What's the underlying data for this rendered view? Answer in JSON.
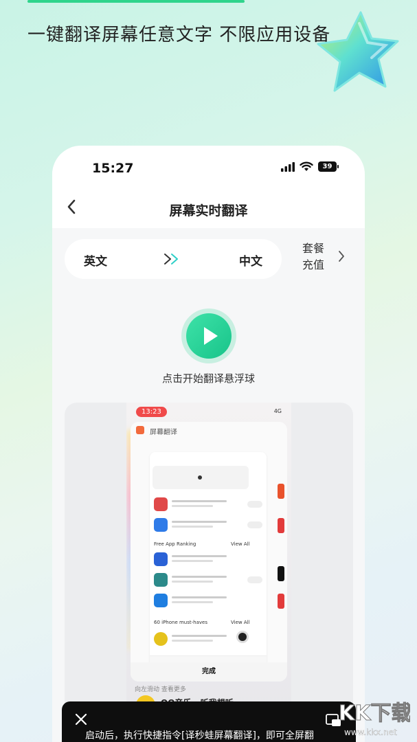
{
  "headline": "一键翻译屏幕任意文字 不限应用设备",
  "status": {
    "time": "15:27",
    "battery": "39"
  },
  "nav": {
    "title": "屏幕实时翻译"
  },
  "lang": {
    "from": "英文",
    "to": "中文"
  },
  "plan": {
    "line1": "套餐",
    "line2": "充值"
  },
  "play": {
    "caption": "点击开始翻译悬浮球"
  },
  "preview": {
    "status_time": "13:23",
    "status_right": "4G",
    "app_title": "屏幕翻译",
    "section1": "Free App Ranking",
    "section1_right": "View All",
    "section2": "60 iPhone must-haves",
    "section2_right": "View All",
    "done_label": "完成",
    "hint": "向左滑动 查看更多",
    "music": "QQ音乐 - 听我想听"
  },
  "toast": {
    "message": "启动后，执行快捷指令[译秒蛙屏幕翻译]，即可全屏翻"
  },
  "watermark": {
    "text": "KK下载",
    "url": "www.kkx.net"
  },
  "colors": {
    "accent": "#2fd48c",
    "play": "#18c48a"
  }
}
